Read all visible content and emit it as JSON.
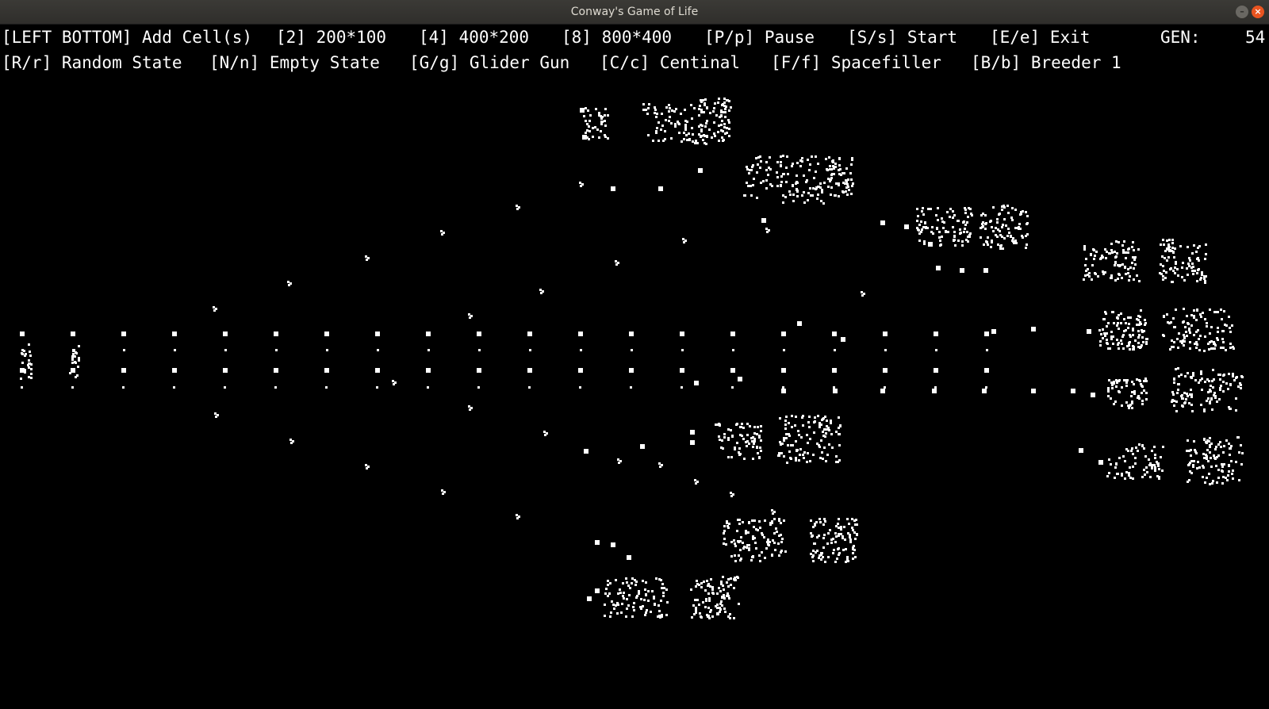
{
  "window": {
    "title": "Conway's Game of Life",
    "minimize_glyph": "–",
    "close_glyph": "×"
  },
  "hud": {
    "row1": [
      "[LEFT BOTTOM] Add Cell(s)",
      "[2] 200*100",
      "[4] 400*200",
      "[8] 800*400",
      "[P/p] Pause",
      "[S/s] Start",
      "[E/e] Exit"
    ],
    "gen_label": "GEN:",
    "gen_value": "54",
    "row2": [
      "[R/r] Random State",
      "[N/n] Empty State",
      "[G/g] Glider Gun",
      "[C/c] Centinal",
      "[F/f] Spacefiller",
      "[B/b] Breeder 1"
    ]
  },
  "colors": {
    "background": "#000000",
    "cell": "#ffffff",
    "text": "#ffffff",
    "close_button": "#e95420"
  }
}
